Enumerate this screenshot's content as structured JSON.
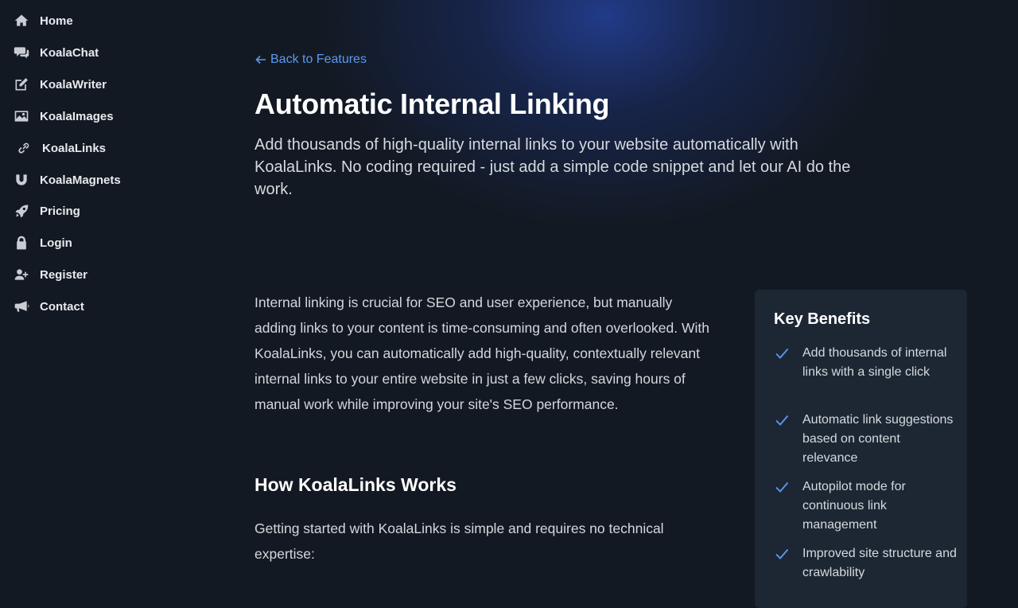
{
  "sidebar": {
    "items": [
      {
        "label": "Home",
        "icon": "home-icon"
      },
      {
        "label": "KoalaChat",
        "icon": "chat-icon"
      },
      {
        "label": "KoalaWriter",
        "icon": "pencil-icon"
      },
      {
        "label": "KoalaImages",
        "icon": "image-icon"
      },
      {
        "label": "KoalaLinks",
        "icon": "link-icon"
      },
      {
        "label": "KoalaMagnets",
        "icon": "magnet-icon"
      },
      {
        "label": "Pricing",
        "icon": "rocket-icon"
      },
      {
        "label": "Login",
        "icon": "lock-icon"
      },
      {
        "label": "Register",
        "icon": "user-plus-icon"
      },
      {
        "label": "Contact",
        "icon": "megaphone-icon"
      }
    ]
  },
  "main": {
    "back_link": "Back to Features",
    "title": "Automatic Internal Linking",
    "subtitle": "Add thousands of high-quality internal links to your website automatically with KoalaLinks. No coding required - just add a simple code snippet and let our AI do the work.",
    "intro": "Internal linking is crucial for SEO and user experience, but manually adding links to your content is time-consuming and often overlooked. With KoalaLinks, you can automatically add high-quality, contextually relevant internal links to your entire website in just a few clicks, saving hours of manual work while improving your site's SEO performance.",
    "section_heading": "How KoalaLinks Works",
    "section_body": "Getting started with KoalaLinks is simple and requires no technical expertise:"
  },
  "benefits": {
    "title": "Key Benefits",
    "items": [
      "Add thousands of internal links with a single click",
      "Automatic link suggestions based on content relevance",
      "Autopilot mode for continuous link management",
      "Improved site structure and crawlability"
    ]
  },
  "colors": {
    "background": "#131922",
    "accent": "#5a9af0",
    "card": "#1d2734"
  }
}
